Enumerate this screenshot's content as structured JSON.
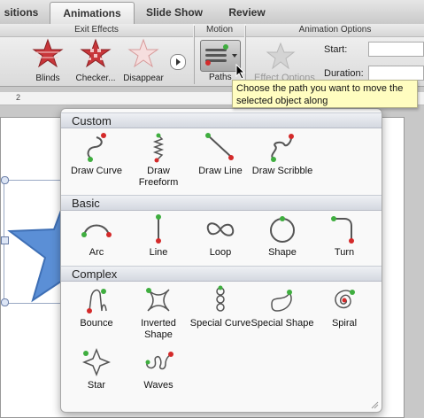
{
  "ribbon": {
    "tabs": [
      "Transitions",
      "Animations",
      "Slide Show",
      "Review"
    ],
    "tab_visible": [
      "sitions",
      "Animations",
      "Slide Show",
      "Review"
    ],
    "active_tab": "Animations",
    "groups": {
      "exit_effects": "Exit Effects",
      "motion": "Motion",
      "animation_options": "Animation Options"
    },
    "exit_effects": [
      {
        "label": "Blinds",
        "icon": "blinds-star-icon"
      },
      {
        "label": "Checker...",
        "icon": "checker-star-icon"
      },
      {
        "label": "Disappear",
        "icon": "disappear-star-icon"
      }
    ],
    "paths_label": "Paths",
    "effect_options_label": "Effect Options",
    "start_label": "Start:",
    "duration_label": "Duration:"
  },
  "ruler": {
    "mark": "2"
  },
  "tooltip": "Choose the path you want to move the selected object along",
  "menu": {
    "sections": [
      {
        "title": "Custom",
        "items": [
          {
            "label": "Draw Curve",
            "icon": "draw-curve-icon"
          },
          {
            "label": "Draw Freeform",
            "icon": "draw-freeform-icon"
          },
          {
            "label": "Draw Line",
            "icon": "draw-line-icon"
          },
          {
            "label": "Draw Scribble",
            "icon": "draw-scribble-icon"
          }
        ]
      },
      {
        "title": "Basic",
        "items": [
          {
            "label": "Arc",
            "icon": "arc-path-icon"
          },
          {
            "label": "Line",
            "icon": "line-path-icon"
          },
          {
            "label": "Loop",
            "icon": "loop-path-icon"
          },
          {
            "label": "Shape",
            "icon": "shape-path-icon"
          },
          {
            "label": "Turn",
            "icon": "turn-path-icon"
          }
        ]
      },
      {
        "title": "Complex",
        "items": [
          {
            "label": "Bounce",
            "icon": "bounce-path-icon"
          },
          {
            "label": "Inverted Shape",
            "icon": "inverted-shape-path-icon"
          },
          {
            "label": "Special Curve",
            "icon": "special-curve-path-icon"
          },
          {
            "label": "Special Shape",
            "icon": "special-shape-path-icon"
          },
          {
            "label": "Spiral",
            "icon": "spiral-path-icon"
          },
          {
            "label": "Star",
            "icon": "star-path-icon"
          },
          {
            "label": "Waves",
            "icon": "waves-path-icon"
          }
        ]
      }
    ]
  },
  "colors": {
    "start_point": "#3fae3f",
    "end_point": "#d42a2a",
    "path_stroke": "#555555",
    "tooltip_bg": "#fffdc0",
    "star_fill": "#5b8fd6"
  }
}
